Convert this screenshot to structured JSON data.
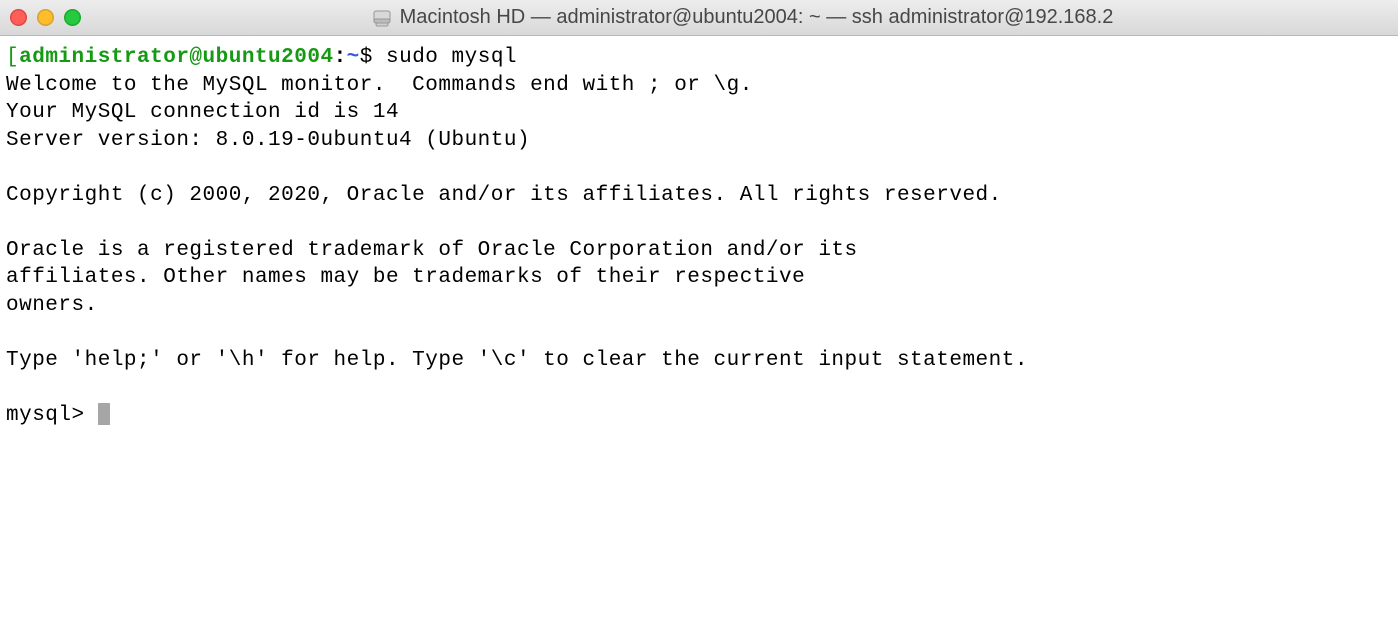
{
  "titlebar": {
    "text": "Macintosh HD — administrator@ubuntu2004: ~ — ssh administrator@192.168.2"
  },
  "prompt": {
    "bracket": "[",
    "userhost": "administrator@ubuntu2004",
    "colon": ":",
    "path": "~",
    "dollar": "$ ",
    "command": "sudo mysql"
  },
  "output": {
    "l1": "Welcome to the MySQL monitor.  Commands end with ; or \\g.",
    "l2": "Your MySQL connection id is 14",
    "l3": "Server version: 8.0.19-0ubuntu4 (Ubuntu)",
    "l4": "",
    "l5": "Copyright (c) 2000, 2020, Oracle and/or its affiliates. All rights reserved.",
    "l6": "",
    "l7": "Oracle is a registered trademark of Oracle Corporation and/or its",
    "l8": "affiliates. Other names may be trademarks of their respective",
    "l9": "owners.",
    "l10": "",
    "l11": "Type 'help;' or '\\h' for help. Type '\\c' to clear the current input statement.",
    "l12": ""
  },
  "mysql_prompt": "mysql> "
}
